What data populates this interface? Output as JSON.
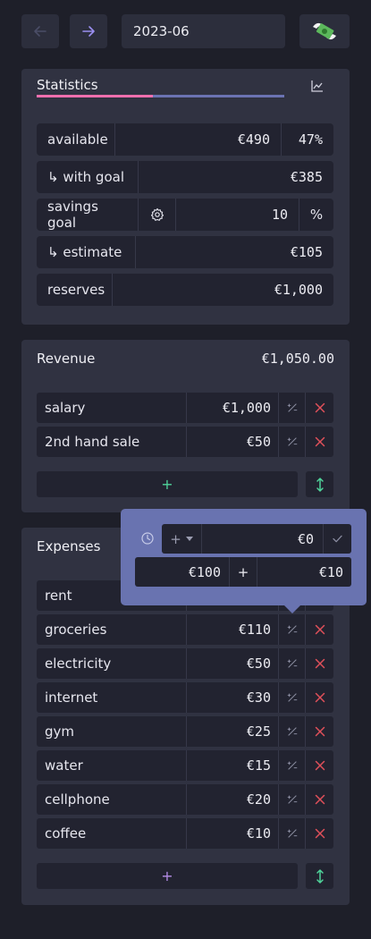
{
  "header": {
    "prev_icon": "arrow-left-icon",
    "next_icon": "arrow-right-icon",
    "month": "2023-06",
    "money_icon": "money-with-wings-icon"
  },
  "statistics": {
    "title": "Statistics",
    "chart_icon": "line-chart-icon",
    "progress": {
      "fraction": 0.47,
      "color_fill": "#f06fae",
      "color_track": "#6b73b3"
    },
    "rows": {
      "available": {
        "label": "available",
        "value": "€490",
        "percent": "47%"
      },
      "with_goal": {
        "label": "↳ with goal",
        "value": "€385"
      },
      "savings_goal": {
        "label": "savings goal",
        "value": "10",
        "unit": "%"
      },
      "estimate": {
        "label": "↳ estimate",
        "value": "€105"
      },
      "reserves": {
        "label": "reserves",
        "value": "€1,000"
      }
    }
  },
  "revenue": {
    "title": "Revenue",
    "total": "€1,050.00",
    "items": [
      {
        "name": "salary",
        "amount": "€1,000"
      },
      {
        "name": "2nd hand sale",
        "amount": "€50"
      }
    ],
    "add_label": "+"
  },
  "expenses": {
    "title": "Expenses",
    "items": [
      {
        "name": "rent",
        "amount": ""
      },
      {
        "name": "groceries",
        "amount": "€110"
      },
      {
        "name": "electricity",
        "amount": "€50"
      },
      {
        "name": "internet",
        "amount": "€30"
      },
      {
        "name": "gym",
        "amount": "€25"
      },
      {
        "name": "water",
        "amount": "€15"
      },
      {
        "name": "cellphone",
        "amount": "€20"
      },
      {
        "name": "coffee",
        "amount": "€10"
      }
    ],
    "add_label": "+"
  },
  "popover": {
    "op_label": "+",
    "input_value": "€0",
    "base_value": "€100",
    "operator": "+",
    "result_value": "€10"
  },
  "colors": {
    "accent_green": "#4fd39a",
    "accent_red": "#e0505a",
    "accent_purple": "#b48ce6",
    "accent_blue": "#8c8ff0"
  }
}
